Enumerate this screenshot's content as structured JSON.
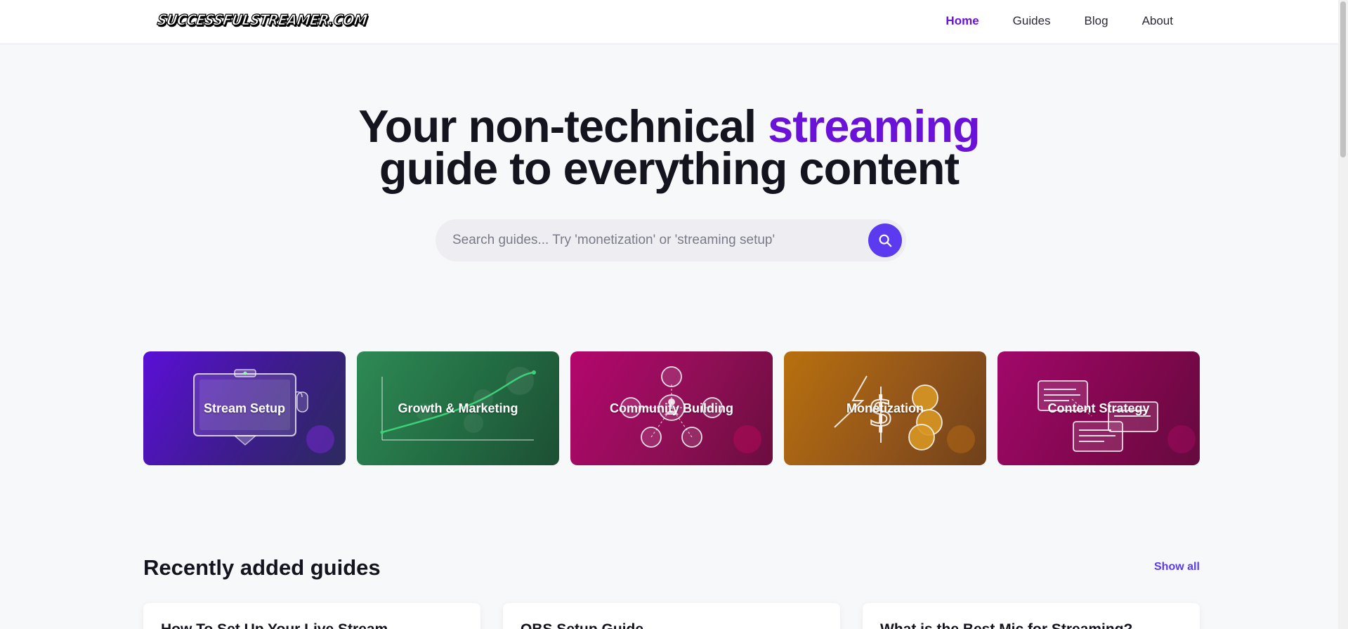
{
  "header": {
    "logo": "SUCCESSFULSTREAMER.COM",
    "nav": [
      "Home",
      "Guides",
      "Blog",
      "About"
    ],
    "active_nav": "Home"
  },
  "hero": {
    "title_part1": "Your non-technical ",
    "title_accent": "streaming",
    "title_part2": "guide to everything content",
    "search_placeholder": "Search guides... Try 'monetization' or 'streaming setup'"
  },
  "categories": [
    {
      "label": "Stream Setup",
      "icon": "monitor-webcam-icon"
    },
    {
      "label": "Growth & Marketing",
      "icon": "growth-chart-icon"
    },
    {
      "label": "Community Building",
      "icon": "network-nodes-icon"
    },
    {
      "label": "Monetization",
      "icon": "coins-icon"
    },
    {
      "label": "Content Strategy",
      "icon": "documents-icon"
    }
  ],
  "recent": {
    "title": "Recently added guides",
    "show_all": "Show all",
    "guides": [
      "How To Set Up Your Live Stream",
      "OBS Setup Guide",
      "What is the Best Mic for Streaming?"
    ]
  },
  "colors": {
    "accent": "#6a12d8",
    "button": "#5b3af0",
    "setup": "#5b0fd6",
    "growth": "#2e8a55",
    "community": "#b4066e",
    "monetization": "#b8700e",
    "content": "#a1086a"
  }
}
